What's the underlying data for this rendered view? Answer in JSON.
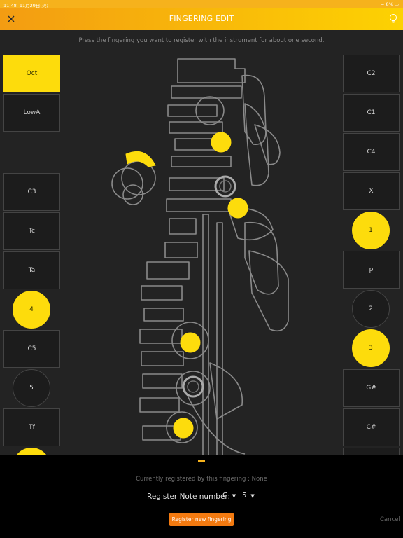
{
  "status": {
    "time": "11:48",
    "date": "11月29日(火)",
    "battery": "8%"
  },
  "header": {
    "title": "FINGERING EDIT"
  },
  "instruction": "Press the fingering you want to register with the instrument for about one second.",
  "left_keys": [
    {
      "label": "Oct",
      "active": true
    },
    {
      "label": "LowA",
      "active": false
    },
    {
      "label": "C3",
      "active": false
    },
    {
      "label": "Tc",
      "active": false
    },
    {
      "label": "Ta",
      "active": false
    },
    {
      "label": "4",
      "active": true
    },
    {
      "label": "C5",
      "active": false
    },
    {
      "label": "5",
      "active": false
    },
    {
      "label": "Tf",
      "active": false
    }
  ],
  "right_keys": [
    {
      "label": "C2",
      "active": false
    },
    {
      "label": "C1",
      "active": false
    },
    {
      "label": "C4",
      "active": false
    },
    {
      "label": "X",
      "active": false
    },
    {
      "label": "1",
      "active": true
    },
    {
      "label": "p",
      "active": false
    },
    {
      "label": "2",
      "active": false
    },
    {
      "label": "3",
      "active": true
    },
    {
      "label": "G#",
      "active": false
    },
    {
      "label": "C#",
      "active": false
    }
  ],
  "bottom": {
    "registered_text": "Currently registered by this fingering : None",
    "note_label": "Register Note number:",
    "note_value": "G",
    "octave_value": "5",
    "register_button": "Register new fingering",
    "cancel_button": "Cancel"
  },
  "colors": {
    "accent": "#fddc0c",
    "header_start": "#f39c12",
    "header_end": "#fdd202",
    "register": "#f37a10"
  }
}
